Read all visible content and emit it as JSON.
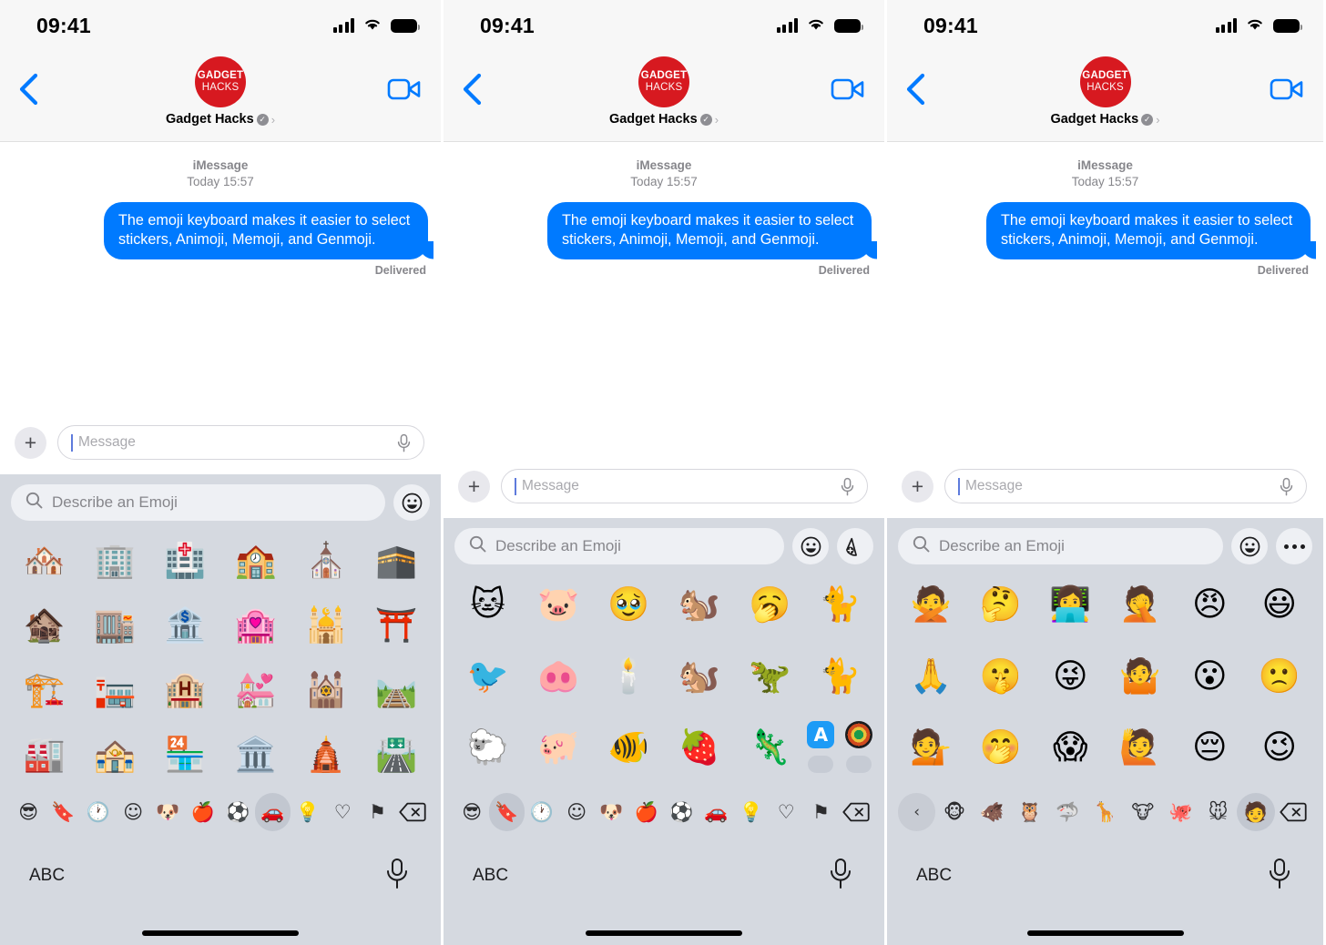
{
  "meta": {
    "screens": 3
  },
  "status_bar": {
    "time": "09:41",
    "signal_icon": "cellular-signal-icon",
    "wifi_icon": "wifi-icon",
    "battery_icon": "battery-full-icon"
  },
  "nav": {
    "back_icon": "chevron-left-icon",
    "video_icon": "facetime-video-icon",
    "avatar_line1": "GADGET",
    "avatar_line2": "HACKS",
    "avatar_color": "#d71920",
    "contact_name": "Gadget Hacks",
    "verified_glyph": "✓",
    "disclosure_glyph": "›"
  },
  "conversation": {
    "service": "iMessage",
    "timestamp": "Today 15:57",
    "bubble_text": "The emoji keyboard makes it easier to select stickers, Animoji, Memoji, and Genmoji.",
    "bubble_color": "#007aff",
    "status": "Delivered"
  },
  "composer": {
    "add_icon": "plus-icon",
    "add_label": "+",
    "placeholder": "Message",
    "value": "",
    "mic_icon": "microphone-icon"
  },
  "keyboard": {
    "search_placeholder": "Describe an Emoji",
    "search_icon": "magnifying-glass-icon",
    "abc_label": "ABC",
    "dictation_icon": "microphone-icon",
    "delete_icon": "delete-backward-icon",
    "prev_icon": "chevron-left-icon"
  },
  "panels": [
    {
      "id": "panel-emoji-travel-places",
      "top_buttons": [
        {
          "name": "emoji-toggle-button",
          "icon": "smiley-face-icon",
          "glyph": "☺"
        }
      ],
      "grid": [
        [
          "🏘️",
          "🏢",
          "🏥",
          "🏫",
          "⛪",
          "🕋"
        ],
        [
          "🏚️",
          "🏬",
          "🏦",
          "🏩",
          "🕌",
          "⛩️"
        ],
        [
          "🏗️",
          "🏣",
          "🏨",
          "💒",
          "🕍",
          "🛤️"
        ],
        [
          "🏭",
          "🏤",
          "🏪",
          "🏛️",
          "🛕",
          "🛣️"
        ]
      ],
      "categories": [
        {
          "name": "category-recents",
          "glyph": "😎",
          "active": false
        },
        {
          "name": "category-stickers",
          "glyph": "🔖",
          "active": false
        },
        {
          "name": "category-frequently-used",
          "glyph": "🕐",
          "active": false
        },
        {
          "name": "category-smileys-people",
          "glyph": "☺",
          "active": false
        },
        {
          "name": "category-animals-nature",
          "glyph": "🐶",
          "active": false
        },
        {
          "name": "category-food-drink",
          "glyph": "🍎",
          "active": false
        },
        {
          "name": "category-activity",
          "glyph": "⚽",
          "active": false
        },
        {
          "name": "category-travel-places",
          "glyph": "🚗",
          "active": true
        },
        {
          "name": "category-objects",
          "glyph": "💡",
          "active": false
        },
        {
          "name": "category-symbols",
          "glyph": "♡",
          "active": false
        },
        {
          "name": "category-flags",
          "glyph": "⚑",
          "active": false
        }
      ]
    },
    {
      "id": "panel-stickers",
      "top_buttons": [
        {
          "name": "emoji-toggle-button",
          "icon": "smiley-face-icon",
          "glyph": "☺"
        },
        {
          "name": "create-sticker-button",
          "icon": "add-sticker-icon",
          "glyph": "🔖"
        }
      ],
      "grid": [
        [
          "🐱",
          "🐷",
          "🥹",
          "🐿️",
          "🥱",
          "🐈"
        ],
        [
          "🐦",
          "🐽",
          "🕯️",
          "🐿️",
          "🦖",
          "🐈"
        ],
        [
          "🐑",
          "🐖",
          "🐠",
          "🍓",
          "🦎",
          ""
        ]
      ],
      "store_row": {
        "app_store_icon": "app-store-icon",
        "app_store_glyph": "A",
        "recent_app_icon": "sticker-app-icon",
        "placeholders": 2
      },
      "categories": [
        {
          "name": "category-recents",
          "glyph": "😎",
          "active": false
        },
        {
          "name": "category-stickers",
          "glyph": "🔖",
          "active": true
        },
        {
          "name": "category-frequently-used",
          "glyph": "🕐",
          "active": false
        },
        {
          "name": "category-smileys-people",
          "glyph": "☺",
          "active": false
        },
        {
          "name": "category-animals-nature",
          "glyph": "🐶",
          "active": false
        },
        {
          "name": "category-food-drink",
          "glyph": "🍎",
          "active": false
        },
        {
          "name": "category-activity",
          "glyph": "⚽",
          "active": false
        },
        {
          "name": "category-travel-places",
          "glyph": "🚗",
          "active": false
        },
        {
          "name": "category-objects",
          "glyph": "💡",
          "active": false
        },
        {
          "name": "category-symbols",
          "glyph": "♡",
          "active": false
        },
        {
          "name": "category-flags",
          "glyph": "⚑",
          "active": false
        }
      ]
    },
    {
      "id": "panel-memoji",
      "top_buttons": [
        {
          "name": "emoji-toggle-button",
          "icon": "smiley-face-icon",
          "glyph": "☺"
        },
        {
          "name": "more-options-button",
          "icon": "ellipsis-icon",
          "glyph": ""
        }
      ],
      "grid": [
        [
          "🙅",
          "🤔",
          "👩‍💻",
          "🤦",
          "😠",
          "😃"
        ],
        [
          "🙏",
          "🤫",
          "😜",
          "🤷",
          "😮",
          "🙁"
        ],
        [
          "💁",
          "🤭",
          "😱",
          "🙋",
          "😔",
          "😉"
        ]
      ],
      "categories": [
        {
          "name": "memoji-prev-button",
          "glyph": "‹",
          "active": false,
          "nav": true
        },
        {
          "name": "memoji-monkey",
          "glyph": "🐵",
          "active": false
        },
        {
          "name": "memoji-boar",
          "glyph": "🐗",
          "active": false
        },
        {
          "name": "memoji-owl",
          "glyph": "🦉",
          "active": false
        },
        {
          "name": "memoji-shark",
          "glyph": "🦈",
          "active": false
        },
        {
          "name": "memoji-giraffe",
          "glyph": "🦒",
          "active": false
        },
        {
          "name": "memoji-cow",
          "glyph": "🐮",
          "active": false
        },
        {
          "name": "memoji-octopus",
          "glyph": "🐙",
          "active": false
        },
        {
          "name": "memoji-mouse",
          "glyph": "🐭",
          "active": false
        },
        {
          "name": "memoji-custom-avatar",
          "glyph": "🧑",
          "active": true
        }
      ]
    }
  ]
}
